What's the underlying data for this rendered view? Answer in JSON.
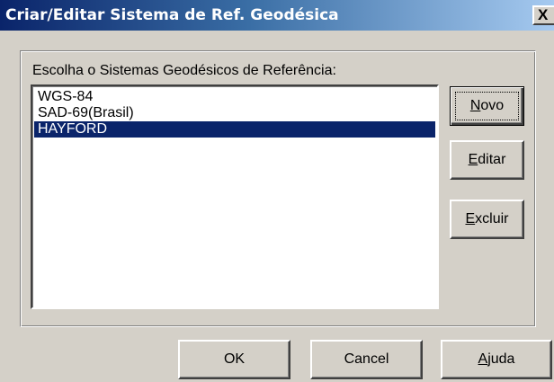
{
  "window": {
    "title": "Criar/Editar Sistema de Ref. Geodésica",
    "close_label": "X"
  },
  "group": {
    "label": "Escolha o Sistemas Geodésicos de Referência:"
  },
  "list": {
    "items": [
      "WGS-84",
      "SAD-69(Brasil)",
      "HAYFORD"
    ],
    "selected_index": 2
  },
  "side_buttons": {
    "novo": {
      "mnemonic": "N",
      "rest": "ovo"
    },
    "editar": {
      "mnemonic": "E",
      "rest": "ditar"
    },
    "excluir": {
      "mnemonic": "E",
      "rest": "xcluir"
    }
  },
  "bottom_buttons": {
    "ok": "OK",
    "cancel": "Cancel",
    "ajuda": {
      "mnemonic": "A",
      "rest": "juda"
    }
  },
  "colors": {
    "selection": "#0a246a",
    "face": "#d4d0c8",
    "title_start": "#0a246a",
    "title_end": "#a6caf0"
  }
}
